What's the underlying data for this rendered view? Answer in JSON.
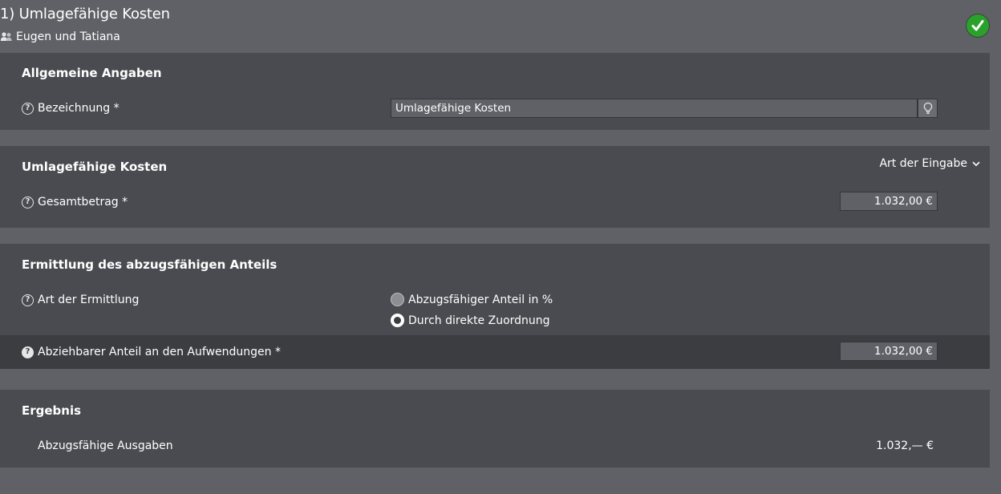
{
  "header": {
    "title": "1) Umlagefähige Kosten",
    "persons": "Eugen und Tatiana"
  },
  "general": {
    "title": "Allgemeine Angaben",
    "designation_label": "Bezeichnung *",
    "designation_value": "Umlagefähige Kosten"
  },
  "costs": {
    "title": "Umlagefähige Kosten",
    "input_mode_label": "Art der Eingabe",
    "total_label": "Gesamtbetrag *",
    "total_value": "1.032,00 €"
  },
  "deduction": {
    "title": "Ermittlung des abzugsfähigen Anteils",
    "method_label": "Art der Ermittlung",
    "option_percent": "Abzugsfähiger Anteil in %",
    "option_direct": "Durch direkte Zuordnung",
    "share_label": "Abziehbarer Anteil an den Aufwendungen *",
    "share_value": "1.032,00 €"
  },
  "result": {
    "title": "Ergebnis",
    "deductible_label": "Abzugsfähige Ausgaben",
    "deductible_value": "1.032,— €"
  },
  "colors": {
    "background": "#5f6166",
    "panel": "#4a4b50",
    "highlight_row": "#3c3d41",
    "success": "#2aa12a"
  }
}
